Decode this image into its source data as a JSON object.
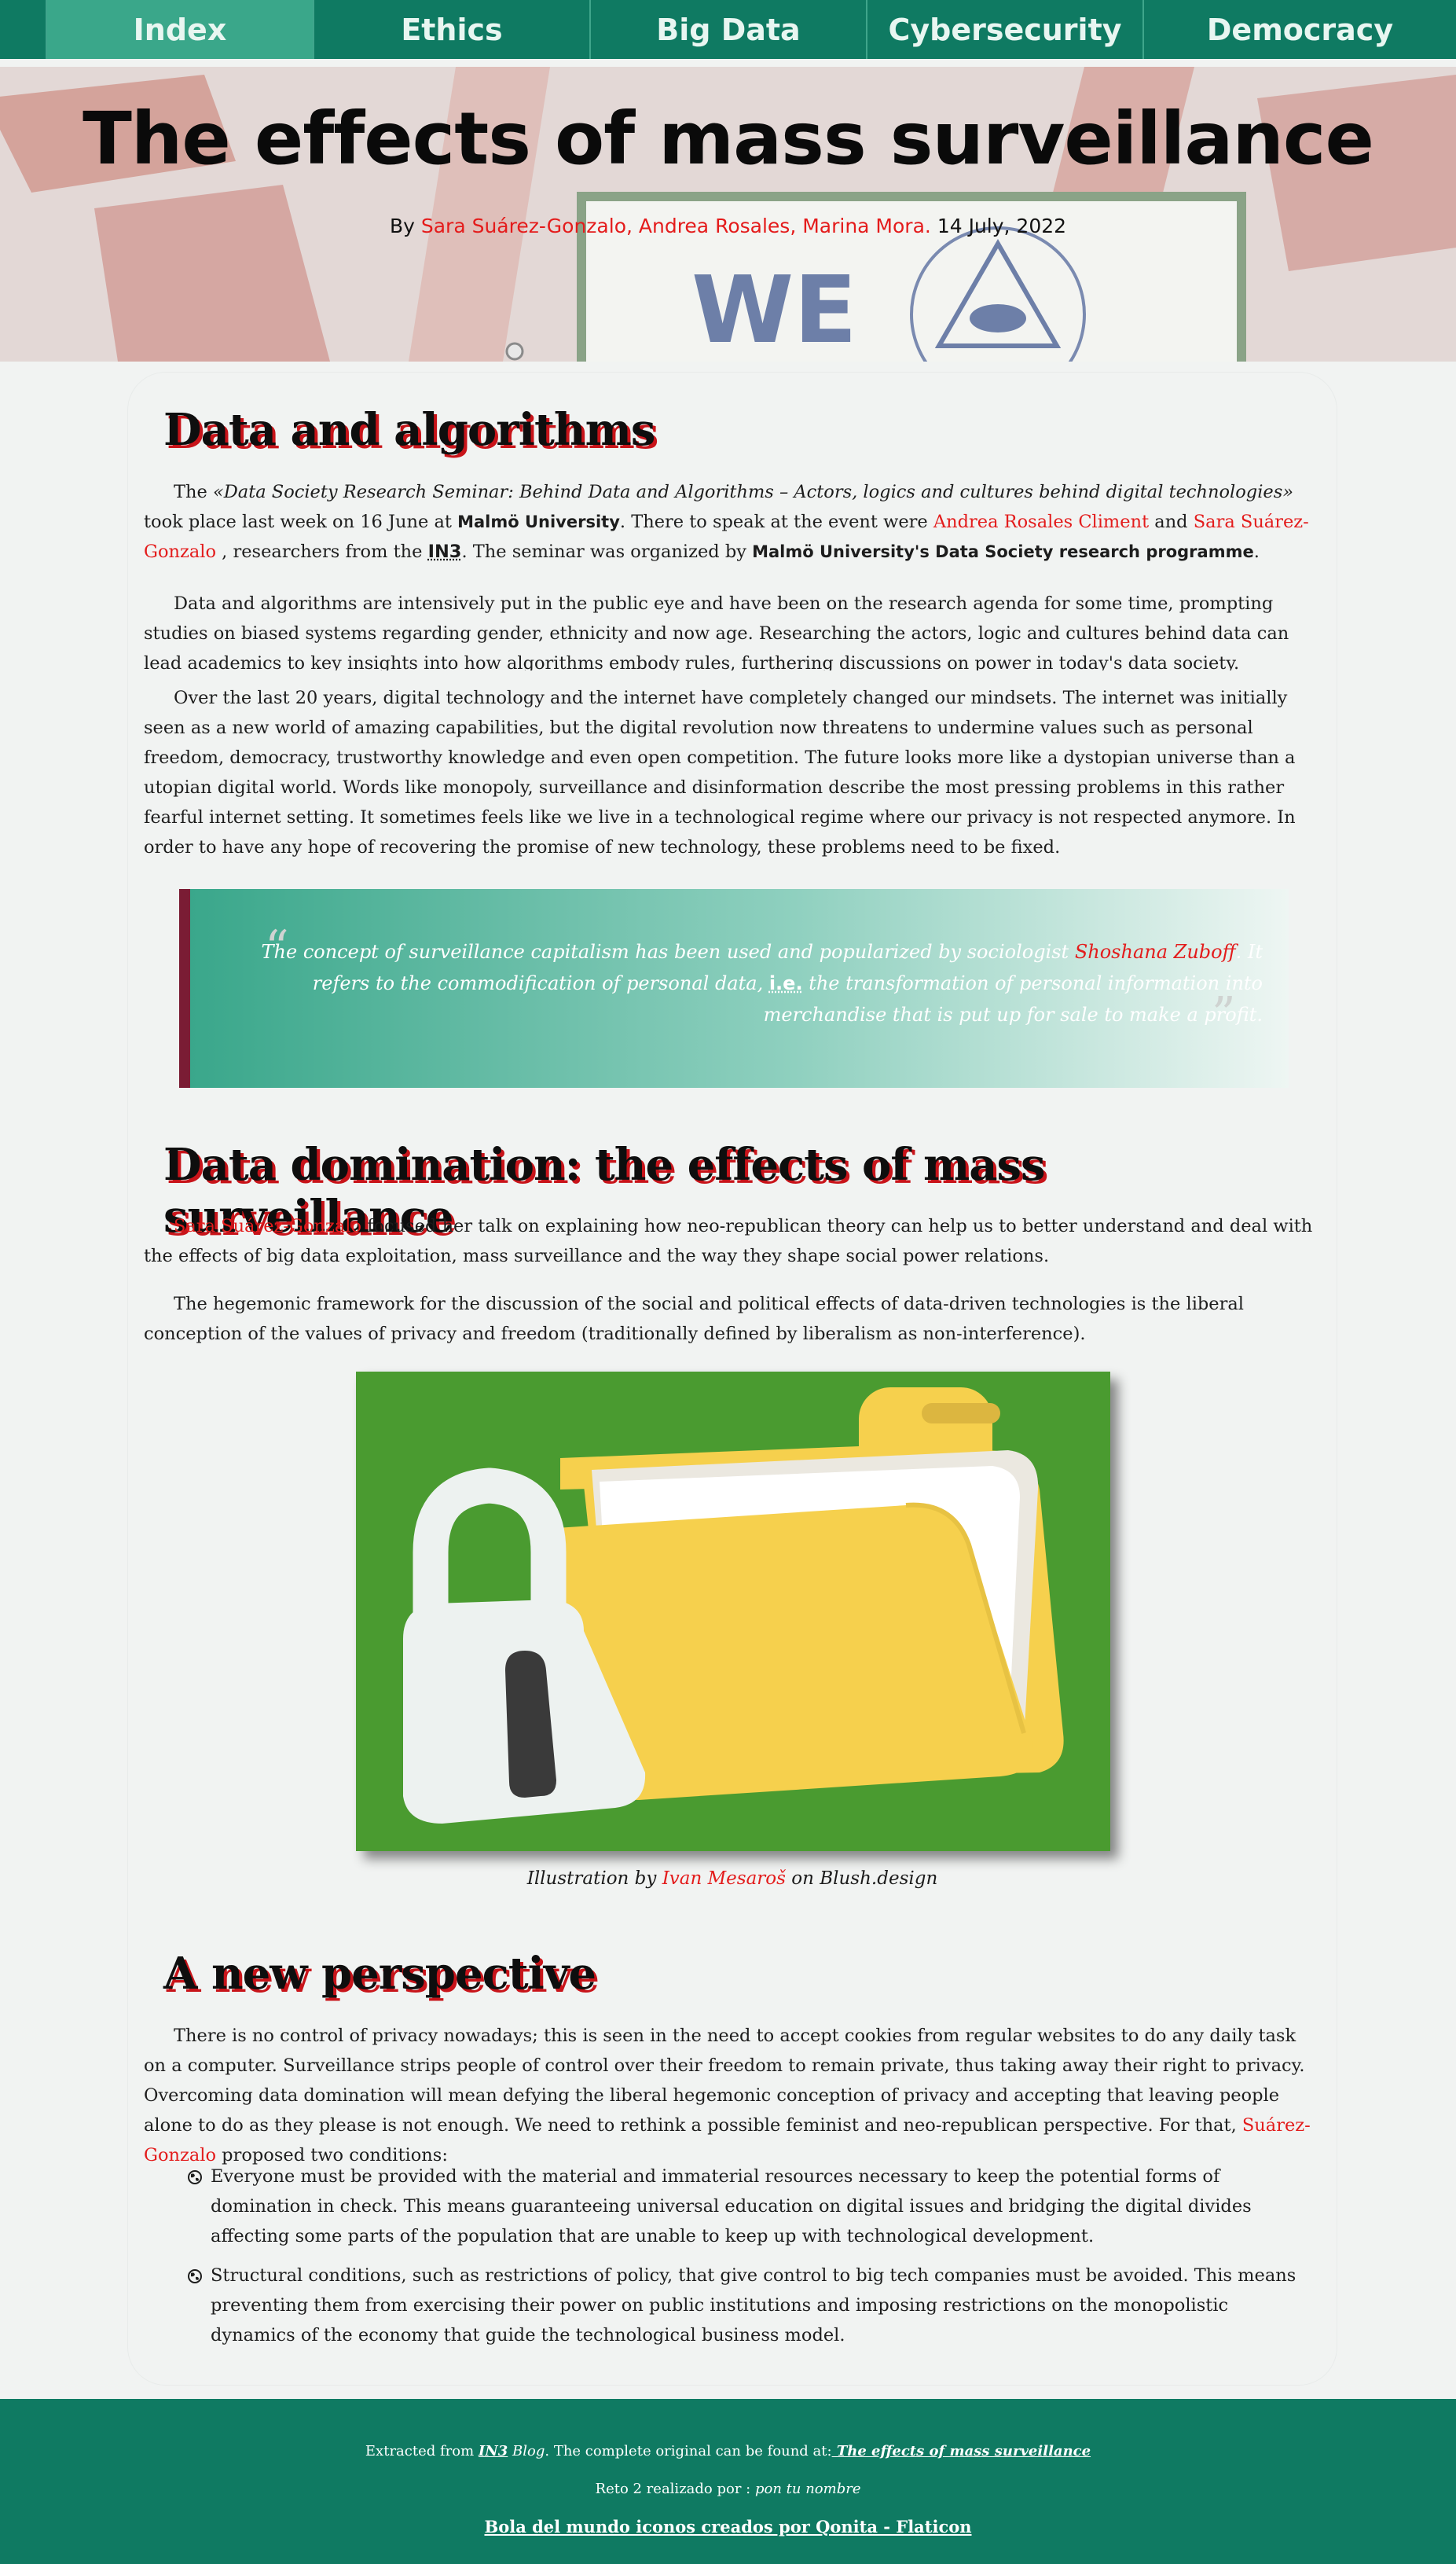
{
  "nav": {
    "items": [
      {
        "label": "Index",
        "active": true
      },
      {
        "label": "Ethics"
      },
      {
        "label": "Big Data"
      },
      {
        "label": "Cybersecurity"
      },
      {
        "label": "Democracy"
      }
    ]
  },
  "hero": {
    "title": "The effects of mass surveillance",
    "by": "By",
    "authors": "Sara Suárez-Gonzalo, Andrea Rosales, Marina Mora.",
    "date": "14 July, 2022",
    "sign_text": "WE"
  },
  "sections": {
    "s1_title": "Data and algorithms",
    "s1_p1": {
      "t1": "The ",
      "t2": "«Data Society Research Seminar: Behind Data and Algorithms – Actors, logics and cultures behind digital technologies»",
      "t3": " took place last week on 16 June at ",
      "t4": "Malmö University",
      "t5": ". There to speak at the event were ",
      "t6": "Andrea Rosales Climent",
      "t7": " and ",
      "t8": "Sara Suárez-Gonzalo",
      "t9": " , researchers from the ",
      "t10": "IN3",
      "t11": ". The seminar was organized by ",
      "t12": "Malmö University's Data Society research programme",
      "t13": "."
    },
    "s1_p2": "Data and algorithms are intensively put in the public eye and have been on the research agenda for some time, prompting studies on biased systems regarding gender, ethnicity and now age. Researching the actors, logic and cultures behind data can lead academics to key insights into how algorithms embody rules, furthering discussions on power in today's data society.",
    "s1_p3": "Over the last 20 years, digital technology and the internet have completely changed our mindsets. The internet was initially seen as a new world of amazing capabilities, but the digital revolution now threatens to undermine values such as personal freedom, democracy, trustworthy knowledge and even open competition. The future looks more like a dystopian universe than a utopian digital world. Words like monopoly, surveillance and disinformation describe the most pressing problems in this rather fearful internet setting. It sometimes feels like we live in a technological regime where our privacy is not respected anymore. In order to have any hope of recovering the promise of new technology, these problems need to be fixed.",
    "quote": {
      "open": "“",
      "close": "”",
      "t1": "The concept of surveillance capitalism has been used and popularized by sociologist ",
      "name": "Shoshana Zuboff",
      "t2": ". It refers to the commodification of personal data, ",
      "ie": "i.e.",
      "t3": " the transformation of personal information into merchandise that is put up for sale to make a profit."
    },
    "s2_title": "Data domination: the effects of mass surveillance",
    "s2_p1": {
      "name": "Sara Suárez-Gonzalo",
      "rest": " focused her talk on explaining how neo-republican theory can help us to better understand and deal with the effects of big data exploitation, mass surveillance and the way they shape social power relations."
    },
    "s2_p2": "The hegemonic framework for the discussion of the social and political effects of data-driven technologies is the liberal conception of the values of privacy and freedom (traditionally defined by liberalism as non-interference).",
    "caption": {
      "t1": "Illustration by ",
      "name": "Ivan Mesaroš",
      "t2": " on Blush.design"
    },
    "s3_title": "A new perspective",
    "s3_p1": {
      "t1": "There is no control of privacy nowadays; this is seen in the need to accept cookies from regular websites to do any daily task on a computer. Surveillance strips people of control over their freedom to remain private, thus taking away their right to privacy. Overcoming data domination will mean defying the liberal hegemonic conception of privacy and accepting that leaving people alone to do as they please is not enough. We need to rethink a possible feminist and neo-republican perspective. For that, ",
      "name": "Suárez-Gonzalo",
      "t2": " proposed two conditions:"
    },
    "bullets": [
      "Everyone must be provided with the material and immaterial resources necessary to keep the potential forms of domination in check. This means guaranteeing universal education on digital issues and bridging the digital divides affecting some parts of the population that are unable to keep up with technological development.",
      "Structural conditions, such as restrictions of policy, that give control to big tech companies must be avoided. This means preventing them from exercising their power on public institutions and imposing restrictions on the monopolistic dynamics of the economy that guide the technological business model."
    ]
  },
  "footer": {
    "line1_a": "Extracted from ",
    "line1_b": "IN3",
    "line1_c": " Blog",
    "line1_d": ". The complete original can be found at:",
    "line1_link": " The effects of mass surveillance",
    "line2_a": "Reto 2 realizado por : ",
    "line2_b": "pon tu nombre",
    "line3": "Bola del mundo iconos creados por Qonita - Flaticon"
  },
  "colors": {
    "nav": "#0f7a62",
    "nav_active": "#3aa78a",
    "accent_red": "#e31c1c",
    "heading_shadow": "#c8141a",
    "quote_border": "#7a1c34",
    "illustration_bg": "#4a9b30",
    "folder": "#f6d04d"
  }
}
